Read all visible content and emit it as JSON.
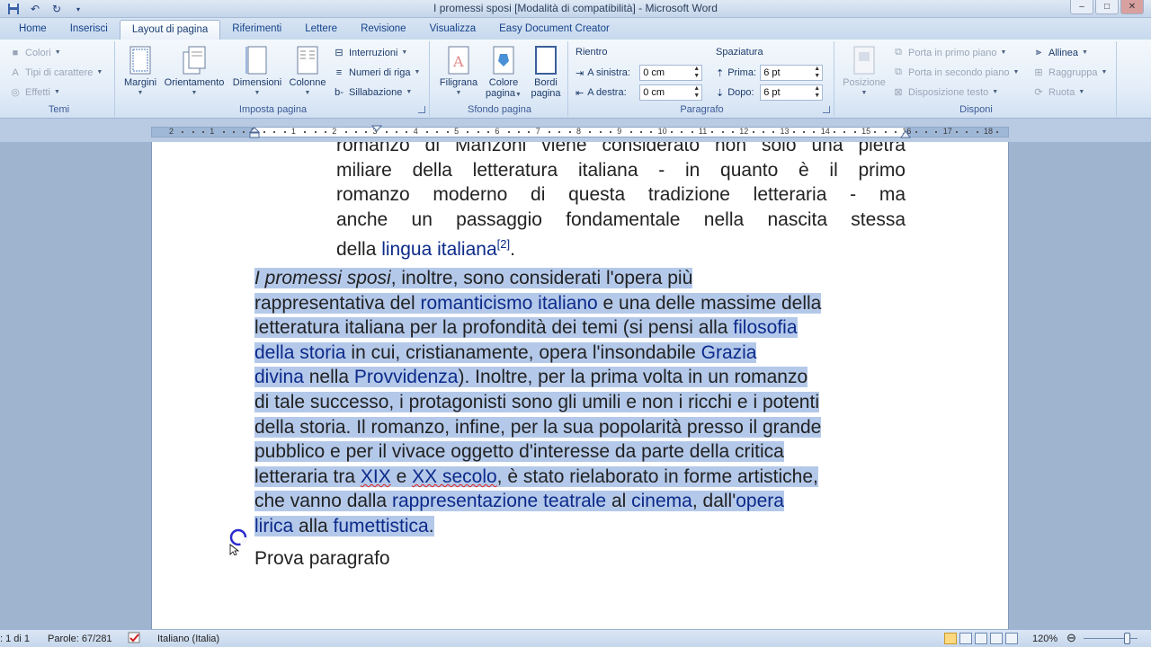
{
  "window": {
    "title": "I promessi sposi [Modalità di compatibilità] - Microsoft Word",
    "controls": [
      "–",
      "□",
      "✕"
    ]
  },
  "tabs": [
    {
      "label": "Home"
    },
    {
      "label": "Inserisci"
    },
    {
      "label": "Layout di pagina",
      "active": true
    },
    {
      "label": "Riferimenti"
    },
    {
      "label": "Lettere"
    },
    {
      "label": "Revisione"
    },
    {
      "label": "Visualizza"
    },
    {
      "label": "Easy Document Creator"
    }
  ],
  "ribbon": {
    "temi": {
      "label": "Temi",
      "colori": "Colori",
      "tipi_carattere": "Tipi di carattere",
      "effetti": "Effetti"
    },
    "imposta_pagina": {
      "label": "Imposta pagina",
      "margini": "Margini",
      "orientamento": "Orientamento",
      "dimensioni": "Dimensioni",
      "colonne": "Colonne",
      "interruzioni": "Interruzioni",
      "numeri_riga": "Numeri di riga",
      "sillabazione": "Sillabazione"
    },
    "sfondo_pagina": {
      "label": "Sfondo pagina",
      "filigrana": "Filigrana",
      "colore_l1": "Colore",
      "colore_l2": "pagina",
      "bordi_l1": "Bordi",
      "bordi_l2": "pagina"
    },
    "paragrafo": {
      "label": "Paragrafo",
      "rientro_title": "Rientro",
      "a_sinistra_label": "A sinistra:",
      "a_sinistra_value": "0 cm",
      "a_destra_label": "A destra:",
      "a_destra_value": "0 cm",
      "spaziatura_title": "Spaziatura",
      "prima_label": "Prima:",
      "prima_value": "6 pt",
      "dopo_label": "Dopo:",
      "dopo_value": "6 pt"
    },
    "disponi": {
      "label": "Disponi",
      "posizione": "Posizione",
      "primo_piano": "Porta in primo piano",
      "secondo_piano": "Porta in secondo piano",
      "disposizione_testo": "Disposizione testo",
      "allinea": "Allinea",
      "raggruppa": "Raggruppa",
      "ruota": "Ruota"
    }
  },
  "ruler": {
    "labels": [
      "2",
      "1",
      "1",
      "1",
      "2",
      "3",
      "4",
      "5",
      "6",
      "7",
      "8",
      "9",
      "10",
      "11",
      "12",
      "13",
      "14",
      "15",
      "16",
      "17",
      "18"
    ]
  },
  "document": {
    "p1": {
      "l1": "romanzo di Manzoni viene considerato non solo una pietra",
      "l2": "miliare della letteratura italiana - in quanto è il primo",
      "l3": "romanzo moderno di questa tradizione letteraria - ma",
      "l4": "anche un passaggio fondamentale nella nascita stessa",
      "l5a": "della ",
      "l5link": "lingua italiana",
      "l5sup": "[2]",
      "l5b": "."
    },
    "p2": {
      "l1a": "I promessi sposi",
      "l1b": ", inoltre, sono considerati l'opera più",
      "l2a": "rappresentativa del ",
      "l2link": "romanticismo italiano",
      "l2b": " e una delle massime della",
      "l3a": "letteratura italiana per la profondità dei temi (si pensi alla ",
      "l3link": "filosofia",
      "l4link": "della storia",
      "l4b": " in cui, cristianamente, opera l'insondabile ",
      "l4link2": "Grazia",
      "l5link": "divina",
      "l5b": " nella ",
      "l5link2": "Provvidenza",
      "l5c": "). Inoltre, per la prima volta in un romanzo",
      "l6": "di tale successo, i protagonisti sono gli umili e non i ricchi e i potenti",
      "l7": "della storia. Il romanzo, infine, per la sua popolarità presso il grande",
      "l8": "pubblico e per il vivace oggetto d'interesse da parte della critica",
      "l9a": "letteraria tra ",
      "l9link": "XIX",
      "l9b": " e ",
      "l9link2": "XX secolo",
      "l9c": ", è stato rielaborato in forme artistiche,",
      "l10a": "che vanno dalla ",
      "l10link": "rappresentazione teatrale",
      "l10b": " al ",
      "l10link2": "cinema",
      "l10c": ", dall'",
      "l10link3": "opera",
      "l11link": "lirica",
      "l11b": " alla ",
      "l11link2": "fumettistica",
      "l11c": "."
    },
    "p3": "Prova paragrafo"
  },
  "statusbar": {
    "pagina": ": 1 di 1",
    "parole": "Parole: 67/281",
    "lingua": "Italiano (Italia)",
    "zoom": "120%",
    "zoom_level_percent": 120
  },
  "colors": {
    "ribbon_accent": "#15428b",
    "selection": "#b4c9ea",
    "link": "#0c2a8a"
  }
}
